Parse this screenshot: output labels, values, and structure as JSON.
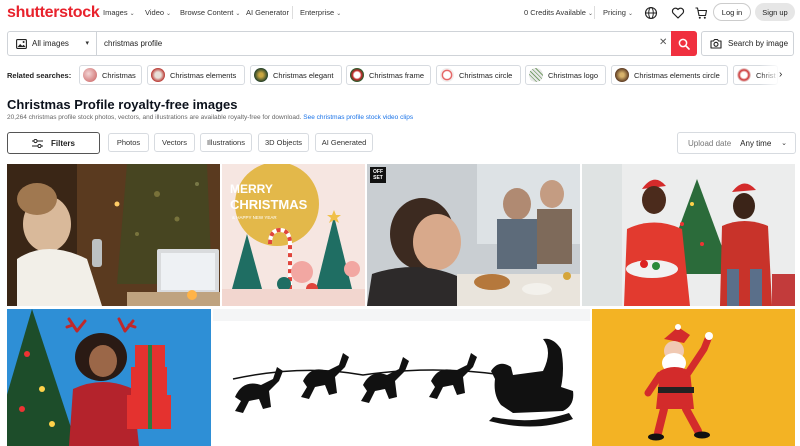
{
  "brand": {
    "name": "shutterstock",
    "color": "#e8222c"
  },
  "nav": {
    "links": [
      {
        "label": "Images"
      },
      {
        "label": "Video"
      },
      {
        "label": "Browse Content"
      },
      {
        "label": "AI Generator"
      },
      {
        "label": "Enterprise"
      }
    ],
    "credits": "0 Credits Available",
    "pricing": "Pricing",
    "login": "Log in",
    "signup": "Sign up"
  },
  "search": {
    "type_label": "All images",
    "value": "christmas profile",
    "image_search_label": "Search by image",
    "accent": "#f0303f"
  },
  "related": {
    "label": "Related searches:",
    "chips": [
      {
        "label": "Christmas"
      },
      {
        "label": "Christmas elements"
      },
      {
        "label": "Christmas elegant"
      },
      {
        "label": "Christmas frame"
      },
      {
        "label": "Christmas circle"
      },
      {
        "label": "Christmas logo"
      },
      {
        "label": "Christmas elements circle"
      },
      {
        "label": "Christ"
      }
    ]
  },
  "results": {
    "title": "Christmas Profile royalty-free images",
    "subtitle": "20,264 christmas profile stock photos, vectors, and illustrations are available royalty-free for download.",
    "video_link": "See christmas profile stock video clips"
  },
  "filters": {
    "button": "Filters",
    "pills": [
      {
        "label": "Photos"
      },
      {
        "label": "Vectors"
      },
      {
        "label": "Illustrations"
      },
      {
        "label": "3D Objects"
      },
      {
        "label": "AI Generated"
      }
    ],
    "date_label": "Upload date",
    "date_value": "Any time"
  },
  "tiles": {
    "card_title": "MERRY",
    "card_title2": "CHRISTMAS",
    "card_sub": "& HAPPY NEW YEAR",
    "off_badge": "OFF SET"
  }
}
